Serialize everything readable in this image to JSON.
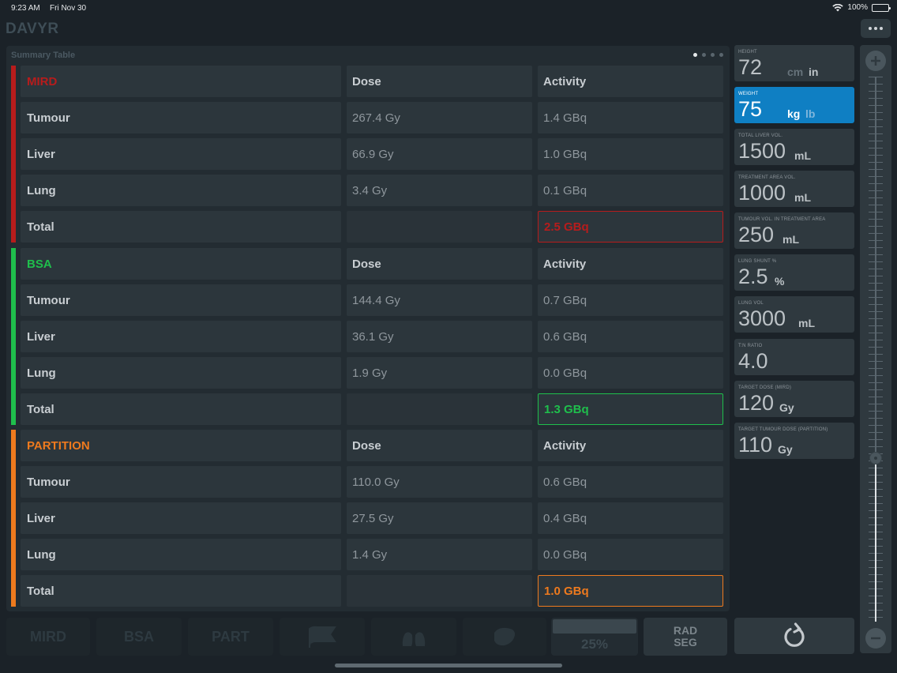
{
  "status": {
    "time": "9:23 AM",
    "date": "Fri Nov 30",
    "battery": "100%"
  },
  "app": {
    "title": "DAVYR"
  },
  "summary": {
    "title": "Summary Table",
    "sections": [
      {
        "name": "MIRD",
        "color": "#b71c1c",
        "col_dose": "Dose",
        "col_activity": "Activity",
        "rows": [
          {
            "label": "Tumour",
            "dose": "267.4 Gy",
            "activity": "1.4 GBq"
          },
          {
            "label": "Liver",
            "dose": "66.9 Gy",
            "activity": "1.0 GBq"
          },
          {
            "label": "Lung",
            "dose": "3.4 Gy",
            "activity": "0.1 GBq"
          }
        ],
        "total_label": "Total",
        "total": "2.5 GBq"
      },
      {
        "name": "BSA",
        "color": "#1fbf4c",
        "col_dose": "Dose",
        "col_activity": "Activity",
        "rows": [
          {
            "label": "Tumour",
            "dose": "144.4 Gy",
            "activity": "0.7 GBq"
          },
          {
            "label": "Liver",
            "dose": "36.1 Gy",
            "activity": "0.6 GBq"
          },
          {
            "label": "Lung",
            "dose": "1.9 Gy",
            "activity": "0.0 GBq"
          }
        ],
        "total_label": "Total",
        "total": "1.3 GBq"
      },
      {
        "name": "PARTITION",
        "color": "#ee7a1e",
        "col_dose": "Dose",
        "col_activity": "Activity",
        "rows": [
          {
            "label": "Tumour",
            "dose": "110.0 Gy",
            "activity": "0.6 GBq"
          },
          {
            "label": "Liver",
            "dose": "27.5 Gy",
            "activity": "0.4 GBq"
          },
          {
            "label": "Lung",
            "dose": "1.4 Gy",
            "activity": "0.0 GBq"
          }
        ],
        "total_label": "Total",
        "total": "1.0 GBq"
      }
    ]
  },
  "params": {
    "height": {
      "label": "HEIGHT",
      "value": "72",
      "unit1": "cm",
      "unit2": "in"
    },
    "weight": {
      "label": "WEIGHT",
      "value": "75",
      "unit1": "kg",
      "unit2": "lb"
    },
    "liver_vol": {
      "label": "TOTAL LIVER VOL.",
      "value": "1500",
      "unit": "mL"
    },
    "treat_vol": {
      "label": "TREATMENT AREA VOL.",
      "value": "1000",
      "unit": "mL"
    },
    "tumour_vol": {
      "label": "TUMOUR VOL. IN TREATMENT AREA",
      "value": "250",
      "unit": "mL"
    },
    "lung_shunt": {
      "label": "LUNG SHUNT %",
      "value": "2.5",
      "unit": "%"
    },
    "lung_vol": {
      "label": "LUNG VOL",
      "value": "3000",
      "unit": "mL"
    },
    "tn_ratio": {
      "label": "T:N RATIO",
      "value": "4.0"
    },
    "target_mird": {
      "label": "TARGET DOSE (MIRD)",
      "value": "120",
      "unit": "Gy"
    },
    "target_partition": {
      "label": "TARGET TUMOUR DOSE (PARTITION)",
      "value": "110",
      "unit": "Gy"
    }
  },
  "slider": {
    "level": 0.3
  },
  "toolbar": {
    "mird": "MIRD",
    "bsa": "BSA",
    "part": "PART",
    "pct": "25%",
    "rad": "RAD",
    "seg": "SEG"
  },
  "colors": {
    "accent": "#0f7fc3",
    "mird": "#b71c1c",
    "bsa": "#1fbf4c",
    "partition": "#ee7a1e"
  }
}
